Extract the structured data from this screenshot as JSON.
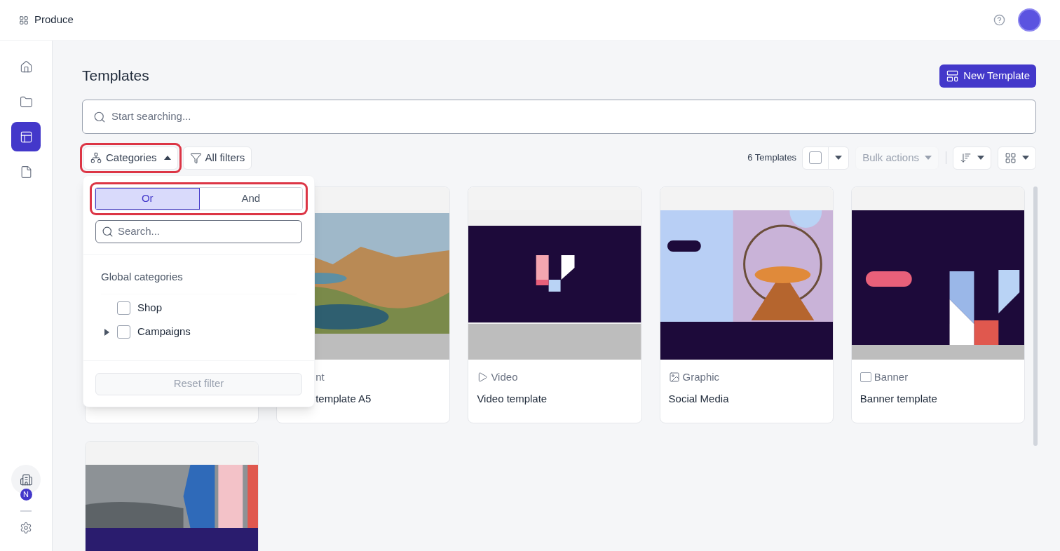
{
  "app": {
    "name": "Produce"
  },
  "sidebar": {
    "items": [
      {
        "kind": "home",
        "selected": false
      },
      {
        "kind": "folder",
        "selected": false
      },
      {
        "kind": "templates",
        "selected": true
      },
      {
        "kind": "document",
        "selected": false
      }
    ],
    "workspace_badge": "N"
  },
  "page": {
    "title": "Templates",
    "new_button": "New Template",
    "search_placeholder": "Start searching..."
  },
  "toolbar": {
    "categories_button": {
      "label": "Categories",
      "expanded": true,
      "highlighted": true
    },
    "filters_button": "All filters",
    "count": "6 Templates",
    "select_all_checked": false,
    "bulk_actions": {
      "label": "Bulk actions",
      "disabled": true
    }
  },
  "categories_menu": {
    "modes": [
      {
        "label": "Or",
        "selected": true
      },
      {
        "label": "And",
        "selected": false
      }
    ],
    "modes_highlighted": true,
    "search_placeholder": "Search...",
    "group_title": "Global categories",
    "items": [
      {
        "label": "Shop",
        "checked": false
      },
      {
        "label": "Campaigns",
        "checked": false,
        "expanded": false
      }
    ],
    "reset_button": {
      "label": "Reset filter",
      "disabled": true
    }
  },
  "templates": [
    {
      "kind": "hidden"
    },
    {
      "kind": "print",
      "type": "nt",
      "name": "template A5"
    },
    {
      "kind": "video",
      "type": "Video",
      "name": "Video template"
    },
    {
      "kind": "graphic",
      "type": "Graphic",
      "name": "Social Media"
    },
    {
      "kind": "banner",
      "type": "Banner",
      "name": "Banner template"
    },
    {
      "kind": "brand"
    }
  ]
}
